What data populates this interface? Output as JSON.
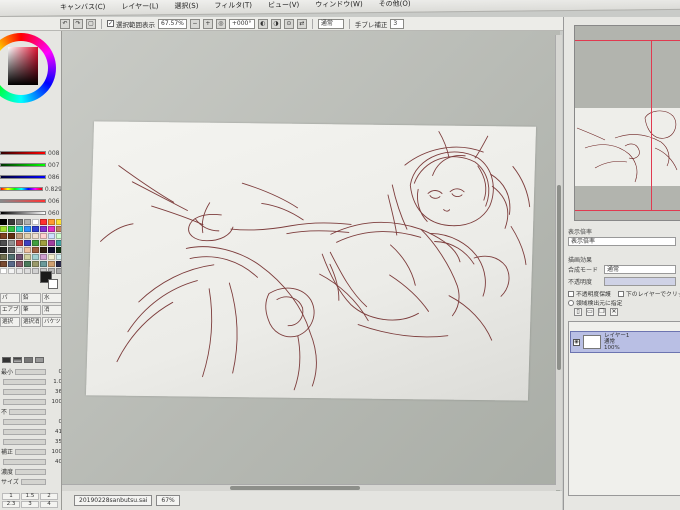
{
  "menu": {
    "items": [
      "キャンバス(C)",
      "レイヤー(L)",
      "選択(S)",
      "フィルタ(T)",
      "ビュー(V)",
      "ウィンドウ(W)",
      "その他(O)"
    ]
  },
  "toolbar": {
    "selection_label": "選択範囲表示",
    "zoom_value": "67.57%",
    "angle_value": "+000°",
    "blend_label": "通常",
    "stabilizer_label": "手ブレ補正",
    "stabilizer_value": "3"
  },
  "left_panel": {
    "rgb_values": [
      "008",
      "007",
      "086",
      "0.829",
      "006",
      "060"
    ],
    "tool_labels": [
      "パ",
      "鉛",
      "水",
      "エアブ",
      "筆",
      "消",
      "選択",
      "選択消",
      "バケツ"
    ],
    "prop_rows": [
      {
        "label": "最小",
        "value": "0"
      },
      {
        "label": "",
        "value": "1.0"
      },
      {
        "label": "",
        "value": "36"
      },
      {
        "label": "",
        "value": "100"
      },
      {
        "label": "不",
        "value": ""
      },
      {
        "label": "",
        "value": "0"
      },
      {
        "label": "",
        "value": "41"
      },
      {
        "label": "",
        "value": "35"
      },
      {
        "label": "補正",
        "value": "100"
      },
      {
        "label": "",
        "value": "40"
      },
      {
        "label": "濃度",
        "value": ""
      },
      {
        "label": "サイズ",
        "value": ""
      }
    ],
    "size_options": [
      "1",
      "1.5",
      "2",
      "2.3",
      "3",
      "4"
    ]
  },
  "right_panel": {
    "display_label": "表示倍率",
    "display_value": "表示倍率",
    "effects_label": "描画効果",
    "mode_label": "合成モード",
    "mode_value": "通常",
    "opacity_label": "不透明度",
    "protect_label": "不透明度保護",
    "clip_label": "下のレイヤーでクリッピング",
    "select_source_label": "領域検出元に指定",
    "layer_name": "レイヤー1",
    "layer_mode": "通常",
    "layer_opacity": "100%"
  },
  "status": {
    "file_tab": "20190228sanbutsu.sai",
    "zoom": "67%"
  },
  "colors": {
    "sketch": "#6a1f1f",
    "layer_highlight": "#b9bfe4"
  },
  "swatches": [
    "#000000",
    "#3a3a3a",
    "#7a7a7a",
    "#b0b0b0",
    "#ffffff",
    "#ff3030",
    "#ff9a30",
    "#ffe030",
    "#a0e030",
    "#30c040",
    "#30d0c0",
    "#3090ff",
    "#3040d0",
    "#8030d0",
    "#e030c0",
    "#c08060",
    "#804020",
    "#603010",
    "#c0a080",
    "#e0d0b0",
    "#f0e0d0",
    "#ffd0d0",
    "#d0e0ff",
    "#d0ffd0",
    "#505050",
    "#909090",
    "#c04040",
    "#4040c0",
    "#40a040",
    "#a0a040",
    "#a040a0",
    "#40a0a0",
    "#202020",
    "#606060",
    "#e0e0e0",
    "#f0c0a0",
    "#a06040",
    "#302010",
    "#101030",
    "#103010",
    "#707050",
    "#507070",
    "#705070",
    "#d0d0a0",
    "#a0d0d0",
    "#d0a0d0",
    "#f0f0d0",
    "#d0f0f0",
    "#7a4a30",
    "#5a6a8a",
    "#8a5a6a",
    "#4a7a5a",
    "#9a9a6a",
    "#6a9a9a",
    "#cfa070",
    "#2a2a4a",
    "#ffffff",
    "#f4f4f4",
    "#e8e8e8",
    "#dcdcdc",
    "#d0d0d0",
    "#c4c4c4",
    "#b8b8b8",
    "#acacac"
  ]
}
